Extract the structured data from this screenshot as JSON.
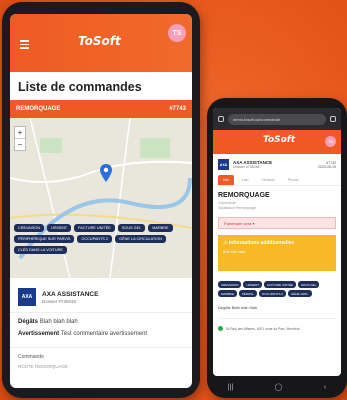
{
  "tablet": {
    "logo": "ToSoft",
    "avatar": "TS",
    "title": "Liste de commandes",
    "order_bar": {
      "type": "REMORQUAGE",
      "id": "#7743"
    },
    "zoom_in": "+",
    "zoom_out": "−",
    "chips": [
      "Crevaison",
      "Urgent",
      "Facture unitée",
      "Sous gel",
      "Marbre",
      "Périphérique sur parvis",
      "Occupants 2",
      "Gêne la circulation",
      "Clés dans la voiture"
    ],
    "client": {
      "logo": "AXA",
      "name": "AXA ASSISTANCE",
      "sub": "Dossier #735048"
    },
    "fields": [
      {
        "label": "Dégâts",
        "value": "Blah blah blah"
      },
      {
        "label": "Avertissement",
        "value": "Test commentaire avertissement"
      }
    ],
    "section": {
      "label": "Commande",
      "value": "ROUTE REMORQUAGE"
    }
  },
  "phone": {
    "url": "demo.tosoft.ca/commande",
    "logo": "ToSoft",
    "avatar": "TS",
    "client": {
      "logo": "AXA",
      "name": "AXA ASSISTANCE",
      "sub": "Dossier #735048",
      "right_top": "#7743",
      "right_bottom": "2023-06-19"
    },
    "tabs": [
      "Info",
      "Lieu",
      "Véhicule",
      "Photos"
    ],
    "service_type": "REMORQUAGE",
    "service_sub": [
      "Commande",
      "Assistance Remorquage"
    ],
    "status": "Partenaire sera ▾",
    "info": {
      "title": "⚠ Informations additionnelles",
      "body": "Blah blah blah"
    },
    "chips": [
      "Crevaison",
      "Urgent",
      "Facture unitée",
      "Sous gel",
      "Marbre",
      "Périph.",
      "Occupants 2",
      "Gêne circ."
    ],
    "field": "Dégâts Blah blah blah",
    "address": "St-Paul des Affaires, 4001 route du Parc, Montréal",
    "nav": [
      "|||",
      "◯",
      "‹"
    ]
  },
  "colors": {
    "accent": "#ef5a24",
    "chip": "#1d2e5b",
    "warning": "#f8b827"
  }
}
